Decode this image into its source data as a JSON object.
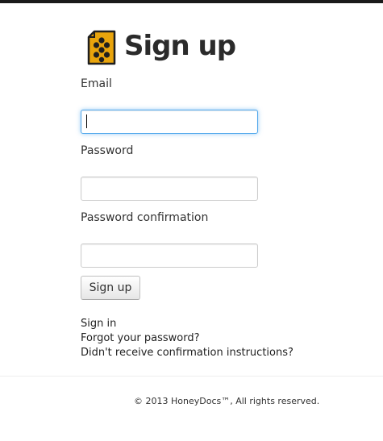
{
  "header": {
    "title": "Sign up",
    "logo_icon": "honeycomb-document-icon",
    "logo_color": "#e8a40c"
  },
  "form": {
    "email_label": "Email",
    "email_value": "",
    "password_label": "Password",
    "password_value": "",
    "password_confirmation_label": "Password confirmation",
    "password_confirmation_value": "",
    "submit_label": "Sign up",
    "focus_color": "#52a8ec"
  },
  "links": {
    "sign_in": "Sign in",
    "forgot_password": "Forgot your password?",
    "confirmation": "Didn't receive confirmation instructions?"
  },
  "footer": {
    "copyright": "© 2013 HoneyDocs™, All rights reserved."
  }
}
